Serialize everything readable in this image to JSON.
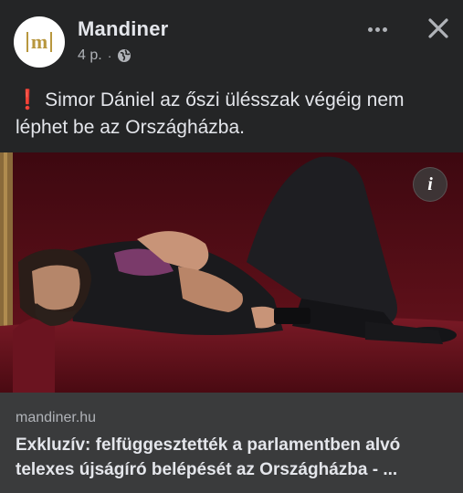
{
  "page": {
    "name": "Mandiner",
    "time": "4 p.",
    "dot": "·",
    "avatar_letter": "m"
  },
  "post": {
    "alert_glyph": "❗",
    "text": "Simor Dániel az őszi ülésszak végéig nem léphet be az Országházba."
  },
  "link": {
    "domain": "mandiner.hu",
    "title": "Exkluzív: felfüggesztették a parlamentben alvó telexes újságíró belépését az Országházba - ..."
  },
  "colors": {
    "background": "#242526",
    "link_footer": "#3a3b3c",
    "brand_gold": "#b8973e",
    "alert_red": "#e41e3f"
  },
  "icons": [
    "more-options-icon",
    "close-icon",
    "globe-icon",
    "info-icon",
    "exclamation-icon"
  ]
}
